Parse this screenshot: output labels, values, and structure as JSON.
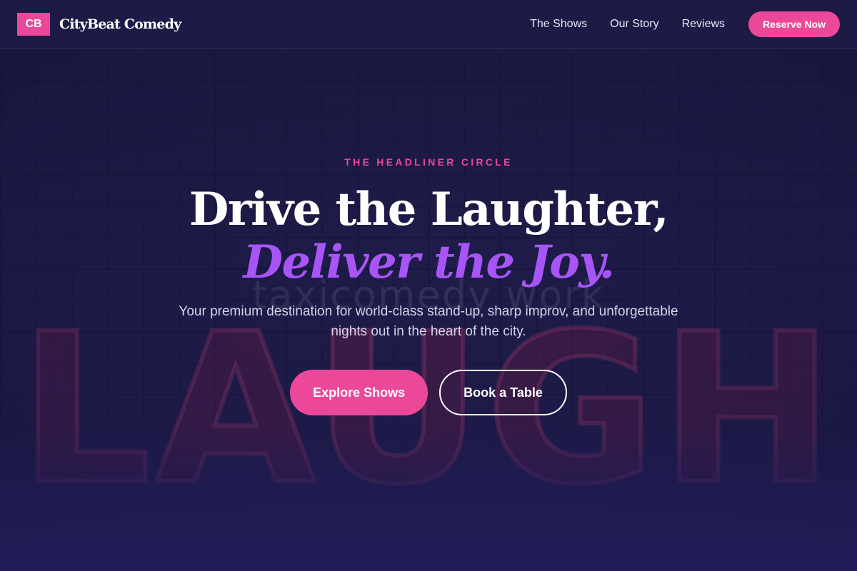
{
  "nav": {
    "logo_badge": "CB",
    "brand_name": "CityBeat Comedy",
    "links": [
      "The Shows",
      "Our Story",
      "Reviews"
    ],
    "cta_label": "Reserve Now"
  },
  "background": {
    "neon_small_text": "taxicomedy work",
    "neon_sign_text": "LAUGH"
  },
  "hero": {
    "eyebrow": "THE HEADLINER CIRCLE",
    "headline": "Drive the Laughter,",
    "headline_accent": "Deliver the Joy.",
    "subtitle": "Your premium destination for world-class stand-up, sharp improv, and unforgettable nights out in the heart of the city.",
    "primary_button": "Explore Shows",
    "secondary_button": "Book a Table"
  },
  "colors": {
    "accent_pink": "#ec4899",
    "accent_purple": "#a855f7",
    "background": "#1e1b4b"
  }
}
